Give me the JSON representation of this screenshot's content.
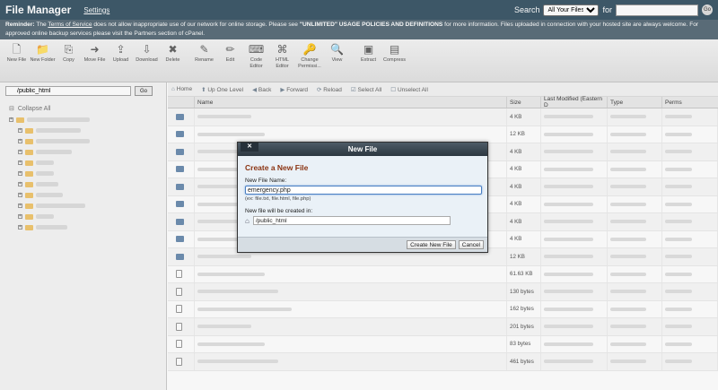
{
  "topbar": {
    "title": "File Manager",
    "settings": "Settings",
    "search_label": "Search",
    "search_scope": "All Your Files",
    "for_label": "for",
    "go": "Go"
  },
  "reminder": {
    "bold": "Reminder:",
    "pre": " The ",
    "tos": "Terms of Service",
    "mid": " does not allow inappropriate use of our network for online storage. Please see ",
    "policy": "\"UNLIMITED\" USAGE POLICIES AND DEFINITIONS",
    "post": " for more information. Files uploaded in connection with your hosted site are always welcome. For approved online backup services please visit the Partners section of cPanel."
  },
  "toolbar": [
    {
      "icon": "new-file-icon",
      "label": "New File"
    },
    {
      "icon": "new-folder-icon",
      "label": "New Folder"
    },
    {
      "icon": "copy-icon",
      "label": "Copy"
    },
    {
      "icon": "move-file-icon",
      "label": "Move File"
    },
    {
      "icon": "upload-icon",
      "label": "Upload"
    },
    {
      "icon": "download-icon",
      "label": "Download"
    },
    {
      "icon": "delete-icon",
      "label": "Delete"
    },
    {
      "icon": "rename-icon",
      "label": "Rename"
    },
    {
      "icon": "edit-icon",
      "label": "Edit"
    },
    {
      "icon": "code-editor-icon",
      "label": "Code Editor"
    },
    {
      "icon": "html-editor-icon",
      "label": "HTML Editor"
    },
    {
      "icon": "change-permissions-icon",
      "label": "Change Permissi..."
    },
    {
      "icon": "view-icon",
      "label": "View"
    },
    {
      "icon": "extract-icon",
      "label": "Extract"
    },
    {
      "icon": "compress-icon",
      "label": "Compress"
    }
  ],
  "left": {
    "path": "/public_html",
    "go": "Go",
    "collapse": "Collapse All"
  },
  "nav": {
    "home": "Home",
    "up": "Up One Level",
    "back": "Back",
    "forward": "Forward",
    "reload": "Reload",
    "select_all": "Select All",
    "unselect_all": "Unselect All"
  },
  "table": {
    "headers": [
      "Name",
      "Size",
      "Last Modified (Eastern D",
      "Type",
      "Perms"
    ],
    "rows": [
      {
        "kind": "folder",
        "size": "4 KB"
      },
      {
        "kind": "folder",
        "size": "12 KB"
      },
      {
        "kind": "folder",
        "size": "4 KB"
      },
      {
        "kind": "folder",
        "size": "4 KB"
      },
      {
        "kind": "folder",
        "size": "4 KB"
      },
      {
        "kind": "folder",
        "size": "4 KB"
      },
      {
        "kind": "folder",
        "size": "4 KB"
      },
      {
        "kind": "folder",
        "size": "4 KB"
      },
      {
        "kind": "folder",
        "size": "12 KB"
      },
      {
        "kind": "file",
        "size": "61.63 KB"
      },
      {
        "kind": "file",
        "size": "130 bytes"
      },
      {
        "kind": "file",
        "size": "162 bytes"
      },
      {
        "kind": "file",
        "size": "201 bytes"
      },
      {
        "kind": "file",
        "size": "83 bytes"
      },
      {
        "kind": "file",
        "size": "461 bytes"
      }
    ]
  },
  "dialog": {
    "title": "New File",
    "close": "✕",
    "heading": "Create a New File",
    "name_label": "New File Name:",
    "name_value": "emergency.php",
    "hint": "(ex: file.txt, file.html, file.php)",
    "location_label": "New file will be created in:",
    "location_value": "/public_html",
    "create": "Create New File",
    "cancel": "Cancel"
  }
}
